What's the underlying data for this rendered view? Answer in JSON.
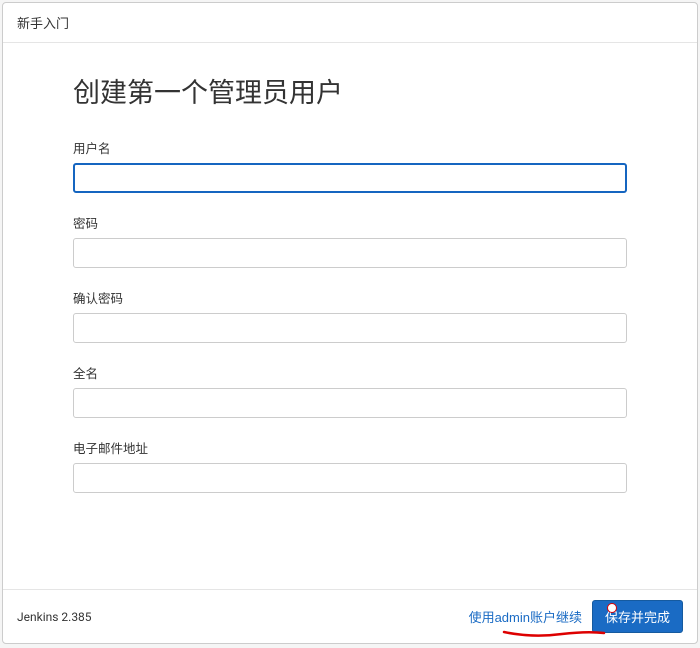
{
  "header": {
    "title": "新手入门"
  },
  "main": {
    "heading": "创建第一个管理员用户",
    "fields": {
      "username": {
        "label": "用户名",
        "value": ""
      },
      "password": {
        "label": "密码",
        "value": ""
      },
      "confirm_password": {
        "label": "确认密码",
        "value": ""
      },
      "fullname": {
        "label": "全名",
        "value": ""
      },
      "email": {
        "label": "电子邮件地址",
        "value": ""
      }
    }
  },
  "footer": {
    "version": "Jenkins 2.385",
    "skip_link": "使用admin账户继续",
    "save_button": "保存并完成"
  }
}
